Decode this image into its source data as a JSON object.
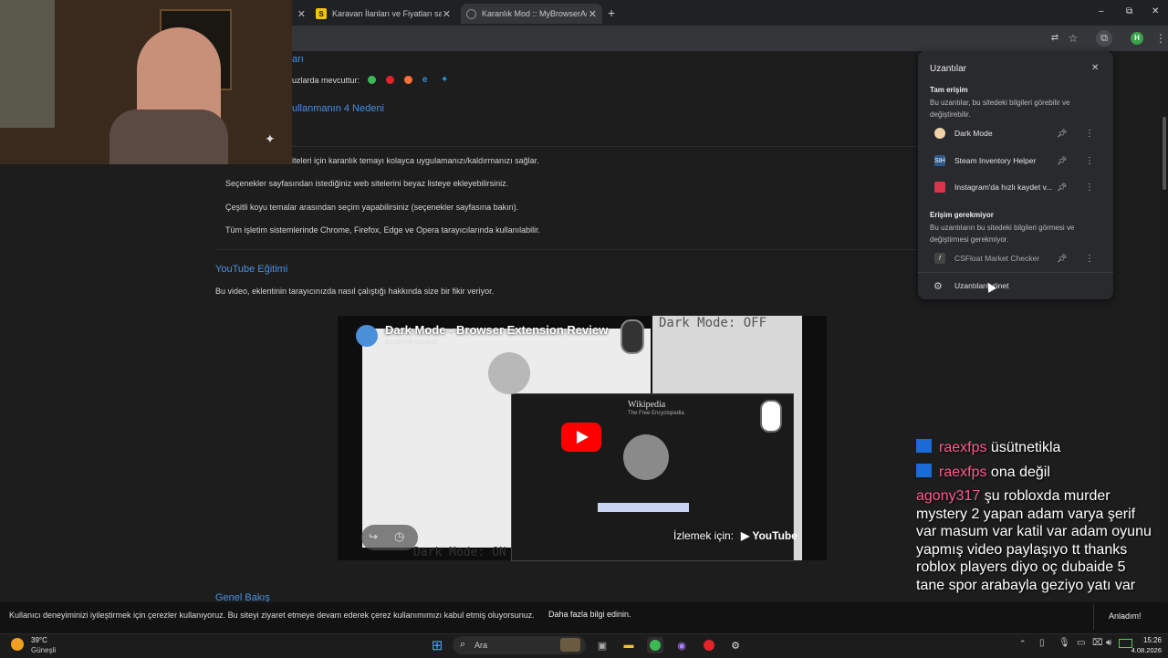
{
  "tabs": [
    {
      "title": "Karavan İlanları ve Fiyatları sah",
      "favicon": "S"
    },
    {
      "title": "Karanlık Mod :: MyBrowserAdd",
      "favicon": ""
    }
  ],
  "new_tab": "+",
  "window_controls": {
    "minimize": "–",
    "maximize": "⧉",
    "close": "✕"
  },
  "profile_initial": "H",
  "page": {
    "heading_partial": "arı",
    "available_label": "uzlarda mevcuttur:",
    "reasons_heading": "ullanmanın 4 Nedeni",
    "bullets": [
      "iteleri için karanlık temayı kolayca uygulamanızı/kaldırmanızı sağlar.",
      "Seçenekler sayfasından istediğiniz web sitelerini beyaz listeye ekleyebilirsiniz.",
      "Çeşitli koyu temalar arasından seçim yapabilirsiniz (seçenekler sayfasına bakın).",
      "Tüm işletim sistemlerinde Chrome, Firefox, Edge ve Opera tarayıcılarında kullanılabilir."
    ],
    "youtube_heading": "YouTube Eğitimi",
    "youtube_desc": "Bu video, eklentinin tarayıcınızda nasıl çalıştığı hakkında size bir fikir veriyor.",
    "overview_heading": "Genel Bakış"
  },
  "video": {
    "title": "Dark Mode - Browser Extension Review",
    "channel": "eccorem project",
    "label_off": "Dark Mode: OFF",
    "label_on": "Dark Mode: ON",
    "watch_on": "İzlemek için:",
    "youtube": "YouTube",
    "wiki_title": "Wikipedia",
    "wiki_subtitle": "The Free Encyclopedia"
  },
  "extensions_popup": {
    "title": "Uzantılar",
    "close": "✕",
    "full_access_title": "Tam erişim",
    "full_access_desc": "Bu uzantılar, bu sitedeki bilgileri görebilir ve değiştirebilir.",
    "full_access_items": [
      {
        "name": "Dark Mode",
        "icon_color": "#f0d2a8"
      },
      {
        "name": "Steam Inventory Helper",
        "icon_color": "#2d5a8a"
      },
      {
        "name": "Instagram'da hızlı kaydet v...",
        "icon_color": "#d8344a"
      }
    ],
    "no_access_title": "Erişim gerekmiyor",
    "no_access_desc": "Bu uzantıların bu sitedeki bilgileri görmesi ve değiştirmesi gerekmiyor.",
    "no_access_items": [
      {
        "name": "CSFloat Market Checker",
        "icon_color": "#444"
      }
    ],
    "manage": "Uzantıları yönet"
  },
  "chat": [
    {
      "user": "raexfps",
      "message": "üsütnetikla",
      "color": "#ff5a8a"
    },
    {
      "user": "raexfps",
      "message": "ona değil",
      "color": "#ff5a8a"
    },
    {
      "user": "agony317",
      "message": "şu robloxda murder mystery 2 yapan adam varya şerif var masum var katil var adam oyunu yapmış video paylaşıyo tt thanks roblox players diyo oç dubaide 5 tane spor arabayla geziyo yatı var",
      "color": "#ff5a8a"
    }
  ],
  "cookie_bar": {
    "text": "Kullanıcı deneyiminizi iyileştirmek için çerezler kullanıyoruz. Bu siteyi ziyaret etmeye devam ederek çerez kullanımımızı kabul etmiş oluyorsunuz.",
    "link": "Daha fazla bilgi edinin.",
    "accept": "Anladım!"
  },
  "taskbar": {
    "weather_temp": "39°C",
    "weather_desc": "Güneşli",
    "search_placeholder": "Ara",
    "time": "15:26",
    "date": "4.08.2026"
  }
}
